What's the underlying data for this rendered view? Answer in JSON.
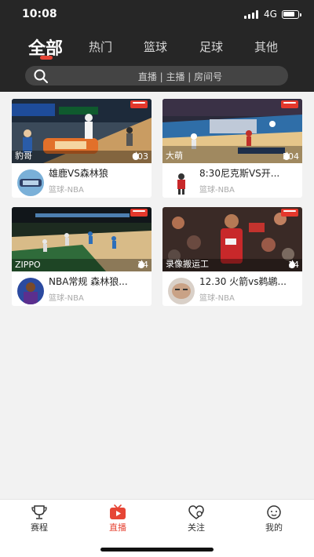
{
  "status_bar": {
    "time": "10:08",
    "network": "4G"
  },
  "tabs": [
    {
      "label": "全部",
      "active": true
    },
    {
      "label": "热门"
    },
    {
      "label": "篮球"
    },
    {
      "label": "足球"
    },
    {
      "label": "其他"
    }
  ],
  "search": {
    "placeholder": "直播 | 主播 | 房间号",
    "icon": "search-icon"
  },
  "streams": [
    {
      "streamer": "豹哥",
      "viewers": "603",
      "title": "雄鹿VS森林狼",
      "category": "篮球-NBA"
    },
    {
      "streamer": "大萌",
      "viewers": "504",
      "title": "8:30尼克斯VS开...",
      "category": "篮球-NBA"
    },
    {
      "streamer": "ZIPPO",
      "viewers": "34",
      "title": "NBA常规 森林狼...",
      "category": "篮球-NBA"
    },
    {
      "streamer": "录像搬运工",
      "viewers": "14",
      "title": "12.30 火箭vs鹈鹕...",
      "category": "篮球-NBA"
    }
  ],
  "bottom_nav": [
    {
      "label": "赛程",
      "icon": "trophy-icon"
    },
    {
      "label": "直播",
      "icon": "live-tv-icon",
      "active": true
    },
    {
      "label": "关注",
      "icon": "heart-icon"
    },
    {
      "label": "我的",
      "icon": "profile-icon"
    }
  ],
  "colors": {
    "accent": "#e64535",
    "header_bg": "#262626",
    "page_bg": "#f2f2f2"
  }
}
